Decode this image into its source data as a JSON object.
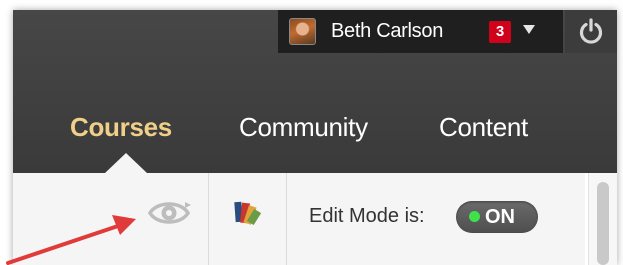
{
  "user": {
    "name": "Beth Carlson",
    "notification_count": "3"
  },
  "nav": {
    "tabs": [
      {
        "label": "Courses",
        "active": true
      },
      {
        "label": "Community",
        "active": false
      },
      {
        "label": "Content",
        "active": false
      }
    ]
  },
  "toolbar": {
    "edit_mode_label": "Edit Mode is:",
    "edit_mode_state": "ON"
  },
  "icons": {
    "avatar": "user-photo",
    "power": "power-icon",
    "preview": "student-preview-icon",
    "palette": "theme-palette-icon"
  },
  "colors": {
    "header_bg": "#3f3f3f",
    "active_tab": "#f0d088",
    "badge": "#d0021b",
    "toggle_dot": "#3ee24a",
    "annotation_arrow": "#e03a3a"
  }
}
